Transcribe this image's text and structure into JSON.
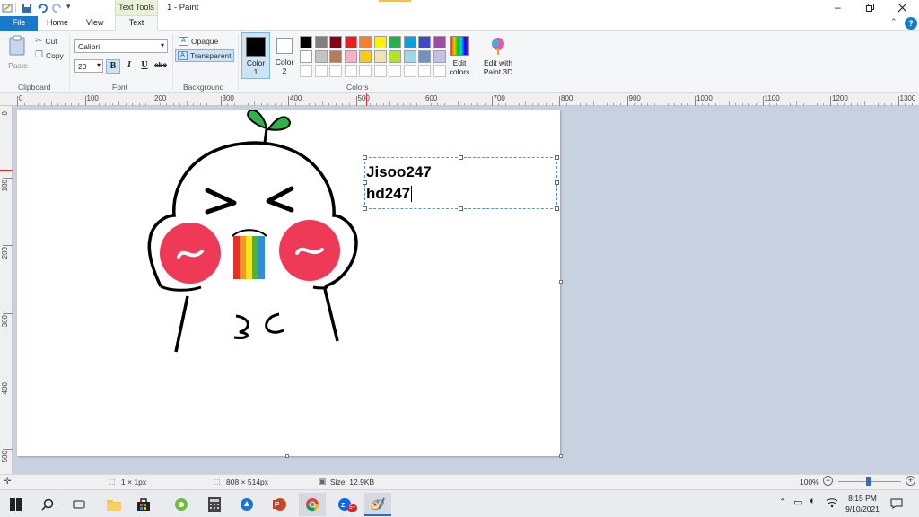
{
  "window": {
    "title": "1 - Paint",
    "context_tab": "Text Tools"
  },
  "tabs": [
    {
      "label": "File"
    },
    {
      "label": "Home"
    },
    {
      "label": "View"
    },
    {
      "label": "Text"
    }
  ],
  "ribbon": {
    "clipboard": {
      "paste": "Paste",
      "cut": "Cut",
      "copy": "Copy",
      "group": "Clipboard"
    },
    "font": {
      "family": "Calibri",
      "size": "20",
      "bold": "B",
      "italic": "I",
      "underline": "U",
      "strike": "abc",
      "group": "Font"
    },
    "background": {
      "opaque": "Opaque",
      "transparent": "Transparent",
      "group": "Background"
    },
    "colors": {
      "color1_line1": "Color",
      "color1_line2": "1",
      "color2_line1": "Color",
      "color2_line2": "2",
      "group": "Colors",
      "edit_line1": "Edit",
      "edit_line2": "colors",
      "paint3d_line1": "Edit with",
      "paint3d_line2": "Paint 3D",
      "color1": "#000000",
      "color2": "#ffffff",
      "palette_row1": [
        "#000000",
        "#7f7f7f",
        "#880015",
        "#ed1c24",
        "#ff7f27",
        "#fff200",
        "#22b14c",
        "#00a2e8",
        "#3f48cc",
        "#a349a4"
      ],
      "palette_row2": [
        "#ffffff",
        "#c3c3c3",
        "#b97a57",
        "#ffaec9",
        "#ffc90e",
        "#efe4b0",
        "#b5e61d",
        "#99d9ea",
        "#7092be",
        "#c8bfe7"
      ]
    }
  },
  "ruler": {
    "h_ticks": [
      "0",
      "100",
      "200",
      "300",
      "400",
      "500",
      "600",
      "700",
      "800",
      "900",
      "1000",
      "1100",
      "1200",
      "1300"
    ],
    "v_ticks": [
      "0",
      "100",
      "200",
      "300",
      "400",
      "500"
    ]
  },
  "canvas": {
    "text_line1": "Jisoo247",
    "text_line2": "hd247"
  },
  "status": {
    "pixel_size": "1 × 1px",
    "image_size": "808 × 514px",
    "file_size": "Size: 12.9KB",
    "zoom": "100%"
  },
  "taskbar": {
    "time": "8:15 PM",
    "date": "9/10/2021",
    "badge": "5+"
  }
}
